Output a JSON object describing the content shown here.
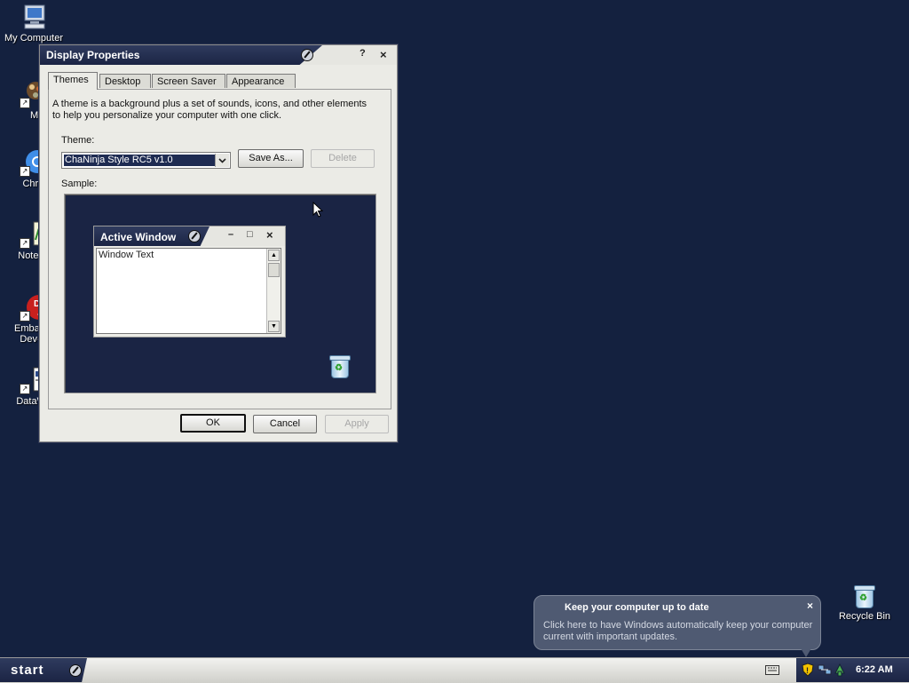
{
  "desktop": {
    "icons": [
      {
        "label": "My Computer",
        "icon": "computer-icon"
      },
      {
        "label": "MyPa",
        "icon": "mypaint-icon"
      },
      {
        "label": "Chrom",
        "icon": "chrome-icon"
      },
      {
        "label": "Notepa",
        "icon": "notepad-icon"
      },
      {
        "label": "Embarca",
        "label2": "Dev-C",
        "icon": "devcpp-icon",
        "badge_text": "DEV"
      },
      {
        "label": "DataWa",
        "icon": "datawarrior-icon"
      }
    ],
    "recycle_bin": {
      "label": "Recycle Bin",
      "icon": "recycle-bin-icon"
    },
    "background_color": "#14213f"
  },
  "dialog": {
    "title": "Display Properties",
    "help_glyph": "?",
    "close_glyph": "×",
    "tabs": [
      "Themes",
      "Desktop",
      "Screen Saver",
      "Appearance"
    ],
    "active_tab": "Themes",
    "description": "A theme is a background plus a set of sounds, icons, and other elements to help you personalize your computer with one click.",
    "theme_label": "Theme:",
    "theme_value": "ChaNinja Style RC5 v1.0",
    "save_as_label": "Save As...",
    "delete_label": "Delete",
    "sample_label": "Sample:",
    "sample": {
      "active_window_title": "Active Window",
      "minimize_glyph": "–",
      "maximize_glyph": "□",
      "close_glyph": "×",
      "window_text": "Window Text"
    },
    "ok_label": "OK",
    "cancel_label": "Cancel",
    "apply_label": "Apply"
  },
  "balloon": {
    "title": "Keep your computer up to date",
    "close_glyph": "×",
    "body": "Click here to have Windows automatically keep your computer current with important updates."
  },
  "taskbar": {
    "start_label": "start",
    "clock": "6:22 AM",
    "tray_icons": [
      "keyboard-icon",
      "security-shield-icon",
      "network-icon",
      "update-icon"
    ]
  },
  "colors": {
    "title_bar": "#1b2444",
    "desktop": "#14213f",
    "dialog_face": "#ebebe6",
    "selection": "#1e2b52"
  }
}
